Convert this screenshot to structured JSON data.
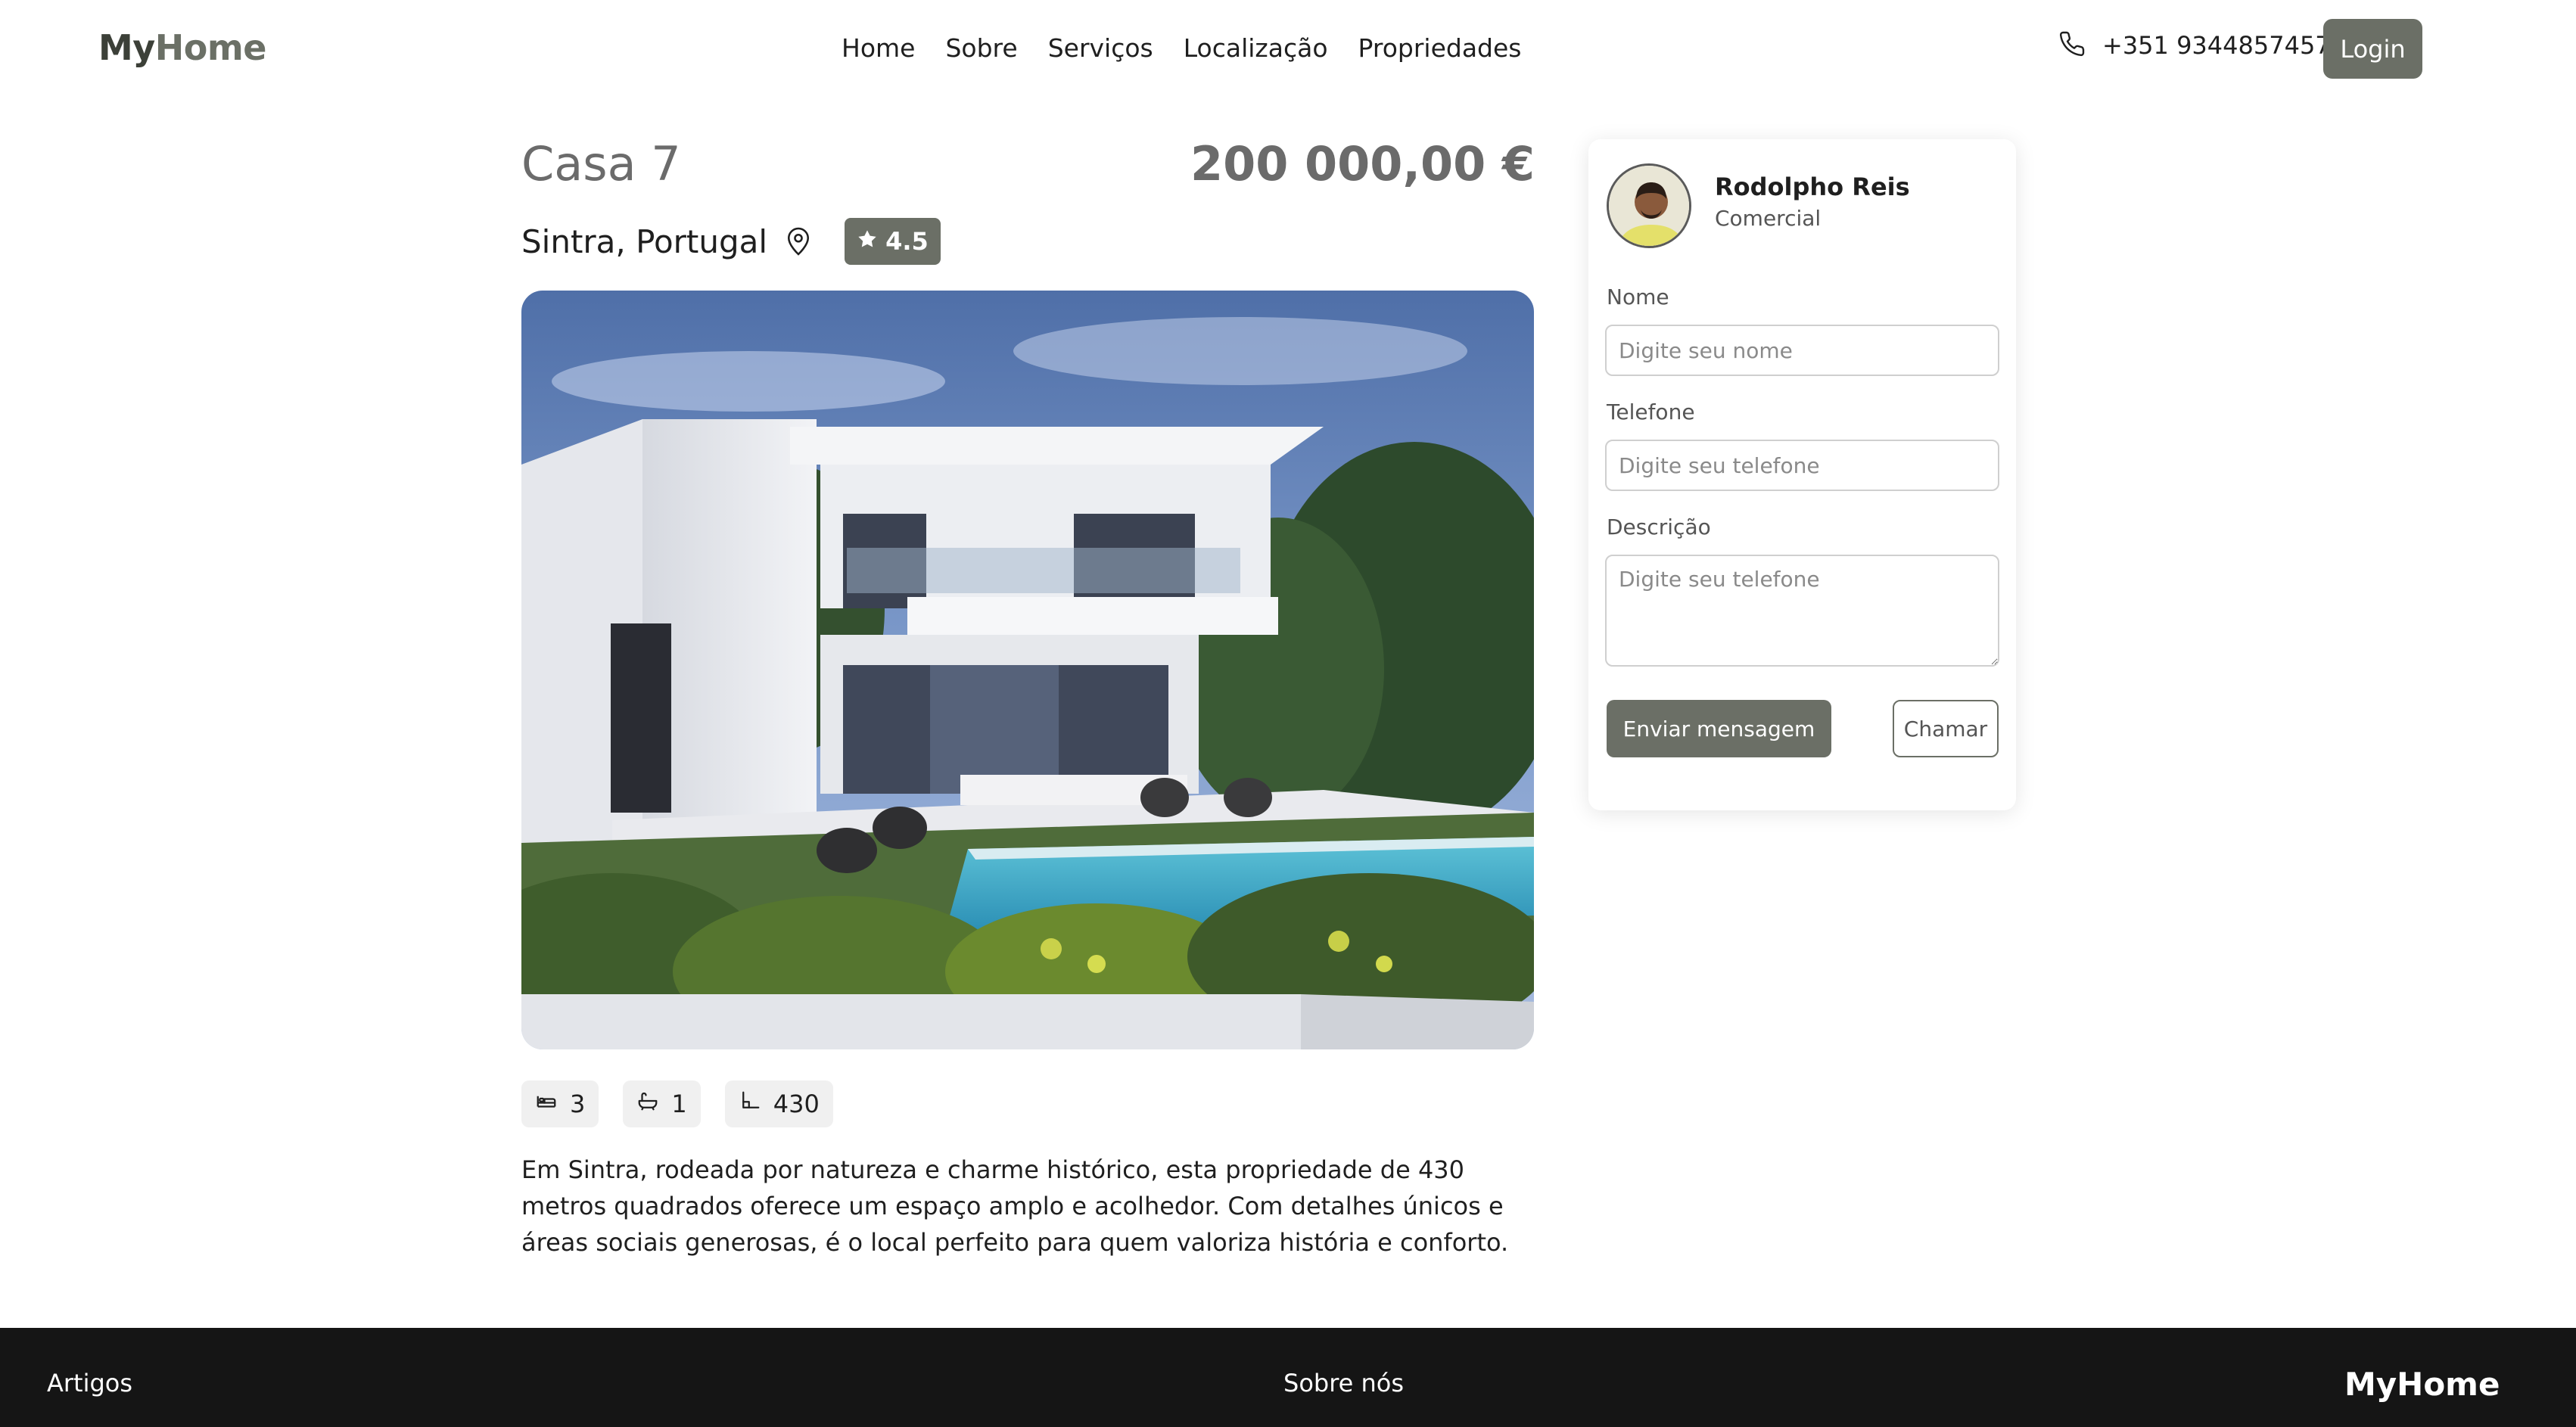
{
  "header": {
    "logo_part1": "My",
    "logo_part2": "Home",
    "nav": [
      "Home",
      "Sobre",
      "Serviços",
      "Localização",
      "Propriedades"
    ],
    "phone_icon": "phone-icon",
    "phone": "+351 9344857457",
    "login_label": "Login"
  },
  "property": {
    "title": "Casa 7",
    "price": "200 000,00 €",
    "location": "Sintra, Portugal",
    "location_icon": "map-pin-icon",
    "rating_icon": "star-icon",
    "rating": "4.5",
    "features": [
      {
        "icon": "bed-icon",
        "value": "3"
      },
      {
        "icon": "bathtub-icon",
        "value": "1"
      },
      {
        "icon": "area-icon",
        "value": "430"
      }
    ],
    "description": "Em Sintra, rodeada por natureza e charme histórico, esta propriedade de 430 metros quadrados oferece um espaço amplo e acolhedor. Com detalhes únicos e áreas sociais generosas, é o local perfeito para quem valoriza história e conforto."
  },
  "agent": {
    "name": "Rodolpho Reis",
    "role": "Comercial"
  },
  "form": {
    "name_label": "Nome",
    "name_placeholder": "Digite seu nome",
    "phone_label": "Telefone",
    "phone_placeholder": "Digite seu telefone",
    "desc_label": "Descrição",
    "desc_placeholder": "Digite seu telefone",
    "send_label": "Enviar mensagem",
    "call_label": "Chamar"
  },
  "footer": {
    "link1": "Artigos",
    "link2": "Sobre nós",
    "logo": "MyHome"
  },
  "colors": {
    "accent": "#6b6f66",
    "footer_bg": "#151515",
    "muted_text": "#6b6b6b"
  }
}
